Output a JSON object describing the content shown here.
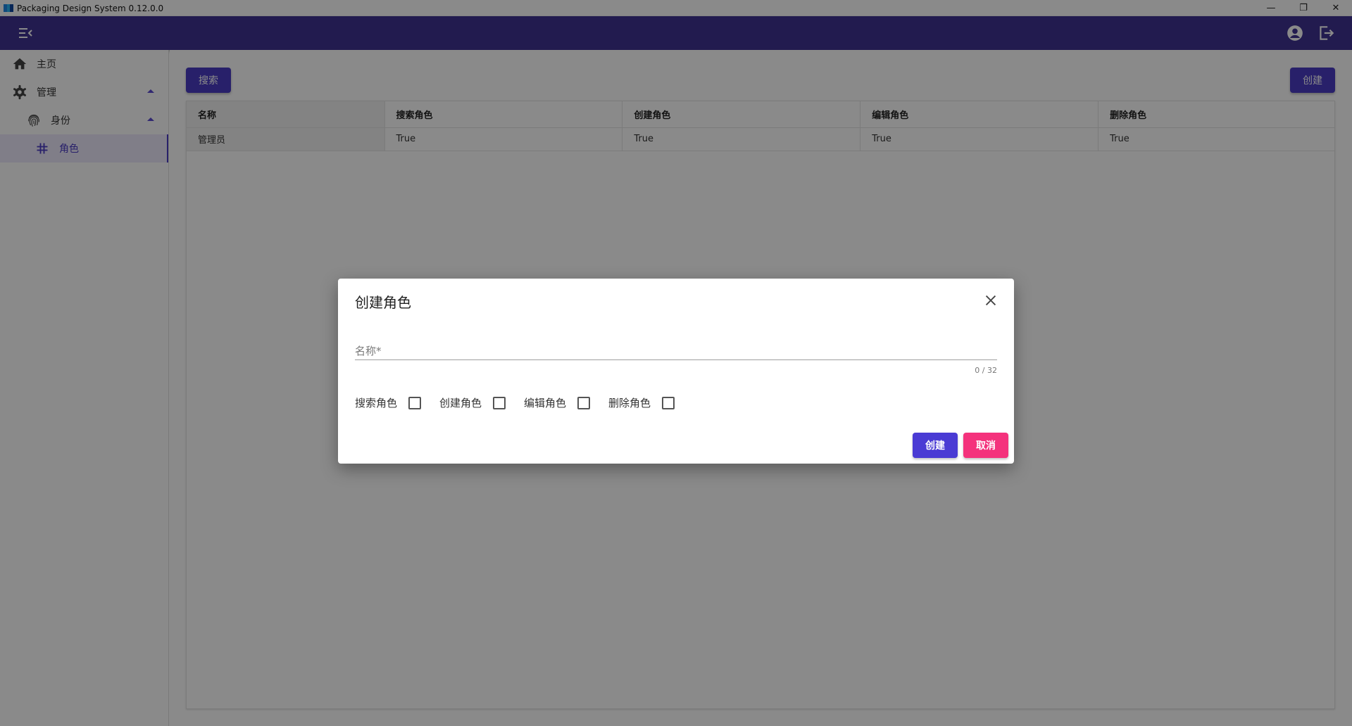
{
  "window": {
    "title": "Packaging Design System 0.12.0.0",
    "minimize_glyph": "—",
    "restore_glyph": "❐",
    "close_glyph": "✕"
  },
  "colors": {
    "appbar": "#3f3292",
    "primary": "#4a3bc4",
    "accent": "#f4327c"
  },
  "sidebar": {
    "items": [
      {
        "label": "主页",
        "icon": "home-icon"
      },
      {
        "label": "管理",
        "icon": "gear-icon"
      },
      {
        "label": "身份",
        "icon": "fingerprint-icon"
      },
      {
        "label": "角色",
        "icon": "hash-icon"
      }
    ]
  },
  "toolbar": {
    "search_label": "搜索",
    "create_label": "创建"
  },
  "table": {
    "headers": [
      "名称",
      "搜索角色",
      "创建角色",
      "编辑角色",
      "删除角色"
    ],
    "rows": [
      [
        "管理员",
        "True",
        "True",
        "True",
        "True"
      ]
    ]
  },
  "dialog": {
    "title": "创建角色",
    "name_label": "名称*",
    "name_value": "",
    "counter": "0 / 32",
    "permissions": [
      {
        "label": "搜索角色",
        "checked": false
      },
      {
        "label": "创建角色",
        "checked": false
      },
      {
        "label": "编辑角色",
        "checked": false
      },
      {
        "label": "删除角色",
        "checked": false
      }
    ],
    "create_label": "创建",
    "cancel_label": "取消"
  }
}
